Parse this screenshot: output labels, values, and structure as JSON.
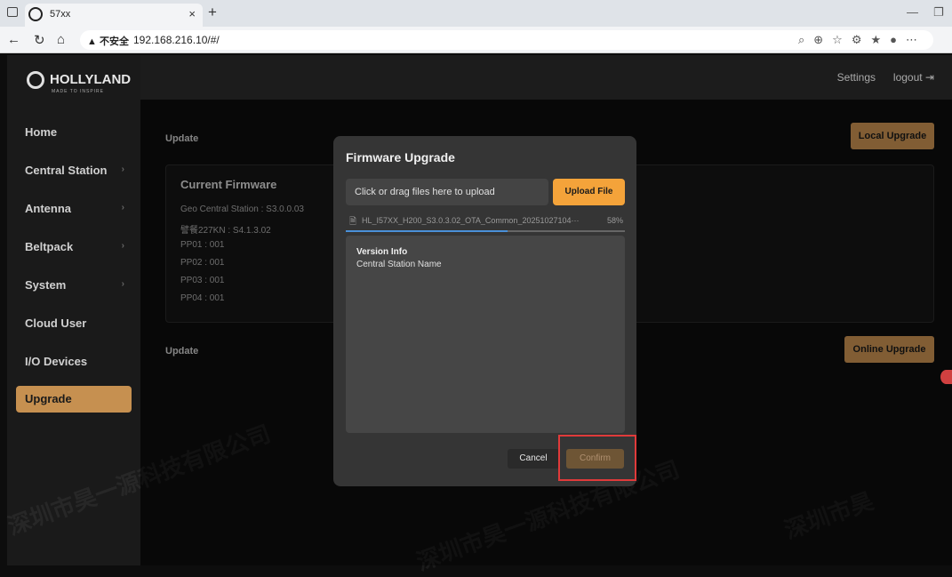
{
  "browser": {
    "tab_title": "57xx",
    "tab_close": "×",
    "new_tab": "+",
    "security_label": "▲ 不安全",
    "url": "192.168.216.10/#/",
    "minimize": "—",
    "restore": "❐"
  },
  "app": {
    "brand": "HOLLYLAND",
    "brand_sub": "MADE TO INSPIRE",
    "topbar": {
      "settings": "Settings",
      "logout": "logout ⇥"
    },
    "sidebar": {
      "items": [
        {
          "label": "Home",
          "has_arrow": false
        },
        {
          "label": "Central Station",
          "has_arrow": true
        },
        {
          "label": "Antenna",
          "has_arrow": true
        },
        {
          "label": "Beltpack",
          "has_arrow": true
        },
        {
          "label": "System",
          "has_arrow": true
        },
        {
          "label": "Cloud User",
          "has_arrow": false
        },
        {
          "label": "I/O Devices",
          "has_arrow": false
        },
        {
          "label": "Upgrade",
          "has_arrow": false,
          "active": true
        }
      ]
    },
    "main": {
      "update_title_1": "Update",
      "local_upgrade": "Local Upgrade",
      "current_firmware": {
        "title": "Current Firmware",
        "lines": [
          "Geo Central Station : S3.0.0.03",
          "譬餐227KN : S4.1.3.02",
          "PP01 : 001",
          "PP02 : 001",
          "PP03 : 001",
          "PP04 : 001"
        ]
      },
      "update_title_2": "Update",
      "online_upgrade": "Online Upgrade"
    },
    "modal": {
      "title": "Firmware Upgrade",
      "drop_hint": "Click or drag files here to upload",
      "upload_button": "Upload File",
      "file_name": "HL_I57XX_H200_S3.0.3.02_OTA_Common_20251027104···",
      "progress_percent": "58%",
      "progress_value": 0.58,
      "version_info_heading": "Version Info",
      "version_info_line": "Central Station Name",
      "cancel": "Cancel",
      "confirm": "Confirm"
    }
  },
  "colors": {
    "accent": "#c69050",
    "upload": "#f4a33a",
    "highlight": "#e03a3a",
    "progress": "#4a90d9"
  }
}
